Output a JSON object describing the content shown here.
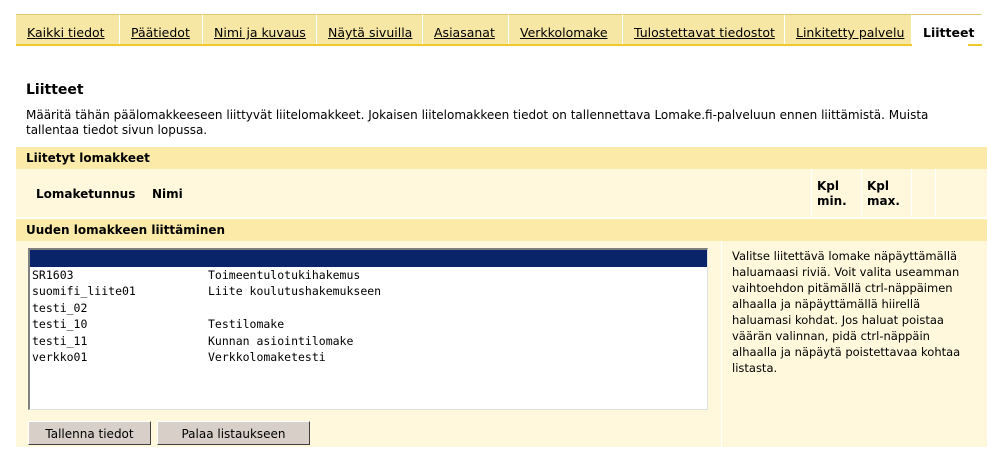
{
  "tabs": [
    {
      "label": "Kaikki tiedot"
    },
    {
      "label": "Päätiedot"
    },
    {
      "label": "Nimi ja kuvaus"
    },
    {
      "label": "Näytä sivuilla"
    },
    {
      "label": "Asiasanat"
    },
    {
      "label": "Verkkolomake"
    },
    {
      "label": "Tulostettavat tiedostot"
    },
    {
      "label": "Linkitetty palvelu"
    },
    {
      "label": "Liitteet",
      "active": true
    }
  ],
  "page": {
    "title": "Liitteet",
    "intro": "Määritä tähän päälomakkeeseen liittyvät liitelomakkeet. Jokaisen liitelomakkeen tiedot on tallennettava Lomake.fi-palveluun ennen liittämistä. Muista tallentaa tiedot sivun lopussa."
  },
  "attached": {
    "title": "Liitetyt lomakkeet",
    "columns": {
      "code": "Lomaketunnus",
      "name": "Nimi",
      "min": "Kpl min.",
      "max": "Kpl max."
    }
  },
  "new_form": {
    "title": "Uuden lomakkeen liittäminen",
    "options": [
      {
        "code": "",
        "name": "",
        "selected": true
      },
      {
        "code": "SR1603",
        "name": "Toimeentulotukihakemus"
      },
      {
        "code": "suomifi_liite01",
        "name": "Liite koulutushakemukseen"
      },
      {
        "code": "testi_02",
        "name": ""
      },
      {
        "code": "testi_10",
        "name": "Testilomake"
      },
      {
        "code": "testi_11",
        "name": "Kunnan asiointilomake"
      },
      {
        "code": "verkko01",
        "name": "Verkkolomaketesti"
      }
    ],
    "help": "Valitse liitettävä lomake näpäyttämällä haluamaasi riviä. Voit valita useamman vaihtoehdon pitämällä ctrl-näppäimen alhaalla ja näpäyttämällä hiirellä haluamasi kohdat. Jos haluat poistaa väärän valinnan, pidä ctrl-näppäin alhaalla ja näpäytä poistettavaa kohtaa listasta."
  },
  "buttons": {
    "save": "Tallenna tiedot",
    "back": "Palaa listaukseen"
  },
  "colors": {
    "tab_bg": "#f7e7a5",
    "accent": "#f0c92b",
    "section_bar": "#fbeaa8",
    "panel_bg": "#fff8dd",
    "selection": "#0a246a"
  }
}
